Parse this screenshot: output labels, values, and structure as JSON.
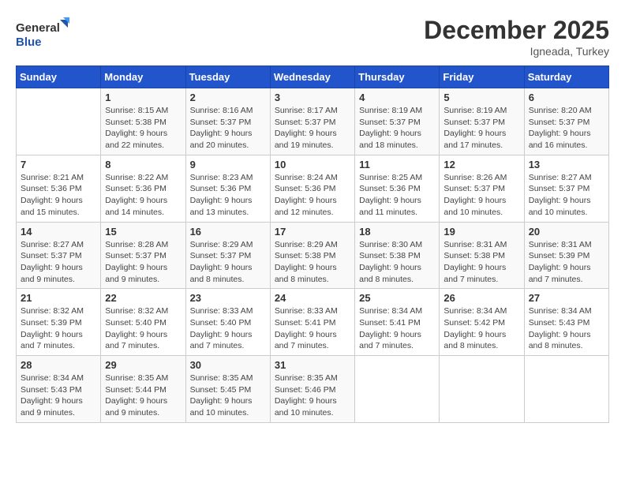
{
  "header": {
    "logo_general": "General",
    "logo_blue": "Blue",
    "month": "December 2025",
    "location": "Igneada, Turkey"
  },
  "days_of_week": [
    "Sunday",
    "Monday",
    "Tuesday",
    "Wednesday",
    "Thursday",
    "Friday",
    "Saturday"
  ],
  "weeks": [
    [
      {
        "day": "",
        "info": ""
      },
      {
        "day": "1",
        "info": "Sunrise: 8:15 AM\nSunset: 5:38 PM\nDaylight: 9 hours and 22 minutes."
      },
      {
        "day": "2",
        "info": "Sunrise: 8:16 AM\nSunset: 5:37 PM\nDaylight: 9 hours and 20 minutes."
      },
      {
        "day": "3",
        "info": "Sunrise: 8:17 AM\nSunset: 5:37 PM\nDaylight: 9 hours and 19 minutes."
      },
      {
        "day": "4",
        "info": "Sunrise: 8:19 AM\nSunset: 5:37 PM\nDaylight: 9 hours and 18 minutes."
      },
      {
        "day": "5",
        "info": "Sunrise: 8:19 AM\nSunset: 5:37 PM\nDaylight: 9 hours and 17 minutes."
      },
      {
        "day": "6",
        "info": "Sunrise: 8:20 AM\nSunset: 5:37 PM\nDaylight: 9 hours and 16 minutes."
      }
    ],
    [
      {
        "day": "7",
        "info": "Sunrise: 8:21 AM\nSunset: 5:36 PM\nDaylight: 9 hours and 15 minutes."
      },
      {
        "day": "8",
        "info": "Sunrise: 8:22 AM\nSunset: 5:36 PM\nDaylight: 9 hours and 14 minutes."
      },
      {
        "day": "9",
        "info": "Sunrise: 8:23 AM\nSunset: 5:36 PM\nDaylight: 9 hours and 13 minutes."
      },
      {
        "day": "10",
        "info": "Sunrise: 8:24 AM\nSunset: 5:36 PM\nDaylight: 9 hours and 12 minutes."
      },
      {
        "day": "11",
        "info": "Sunrise: 8:25 AM\nSunset: 5:36 PM\nDaylight: 9 hours and 11 minutes."
      },
      {
        "day": "12",
        "info": "Sunrise: 8:26 AM\nSunset: 5:37 PM\nDaylight: 9 hours and 10 minutes."
      },
      {
        "day": "13",
        "info": "Sunrise: 8:27 AM\nSunset: 5:37 PM\nDaylight: 9 hours and 10 minutes."
      }
    ],
    [
      {
        "day": "14",
        "info": "Sunrise: 8:27 AM\nSunset: 5:37 PM\nDaylight: 9 hours and 9 minutes."
      },
      {
        "day": "15",
        "info": "Sunrise: 8:28 AM\nSunset: 5:37 PM\nDaylight: 9 hours and 9 minutes."
      },
      {
        "day": "16",
        "info": "Sunrise: 8:29 AM\nSunset: 5:37 PM\nDaylight: 9 hours and 8 minutes."
      },
      {
        "day": "17",
        "info": "Sunrise: 8:29 AM\nSunset: 5:38 PM\nDaylight: 9 hours and 8 minutes."
      },
      {
        "day": "18",
        "info": "Sunrise: 8:30 AM\nSunset: 5:38 PM\nDaylight: 9 hours and 8 minutes."
      },
      {
        "day": "19",
        "info": "Sunrise: 8:31 AM\nSunset: 5:38 PM\nDaylight: 9 hours and 7 minutes."
      },
      {
        "day": "20",
        "info": "Sunrise: 8:31 AM\nSunset: 5:39 PM\nDaylight: 9 hours and 7 minutes."
      }
    ],
    [
      {
        "day": "21",
        "info": "Sunrise: 8:32 AM\nSunset: 5:39 PM\nDaylight: 9 hours and 7 minutes."
      },
      {
        "day": "22",
        "info": "Sunrise: 8:32 AM\nSunset: 5:40 PM\nDaylight: 9 hours and 7 minutes."
      },
      {
        "day": "23",
        "info": "Sunrise: 8:33 AM\nSunset: 5:40 PM\nDaylight: 9 hours and 7 minutes."
      },
      {
        "day": "24",
        "info": "Sunrise: 8:33 AM\nSunset: 5:41 PM\nDaylight: 9 hours and 7 minutes."
      },
      {
        "day": "25",
        "info": "Sunrise: 8:34 AM\nSunset: 5:41 PM\nDaylight: 9 hours and 7 minutes."
      },
      {
        "day": "26",
        "info": "Sunrise: 8:34 AM\nSunset: 5:42 PM\nDaylight: 9 hours and 8 minutes."
      },
      {
        "day": "27",
        "info": "Sunrise: 8:34 AM\nSunset: 5:43 PM\nDaylight: 9 hours and 8 minutes."
      }
    ],
    [
      {
        "day": "28",
        "info": "Sunrise: 8:34 AM\nSunset: 5:43 PM\nDaylight: 9 hours and 9 minutes."
      },
      {
        "day": "29",
        "info": "Sunrise: 8:35 AM\nSunset: 5:44 PM\nDaylight: 9 hours and 9 minutes."
      },
      {
        "day": "30",
        "info": "Sunrise: 8:35 AM\nSunset: 5:45 PM\nDaylight: 9 hours and 10 minutes."
      },
      {
        "day": "31",
        "info": "Sunrise: 8:35 AM\nSunset: 5:46 PM\nDaylight: 9 hours and 10 minutes."
      },
      {
        "day": "",
        "info": ""
      },
      {
        "day": "",
        "info": ""
      },
      {
        "day": "",
        "info": ""
      }
    ]
  ]
}
